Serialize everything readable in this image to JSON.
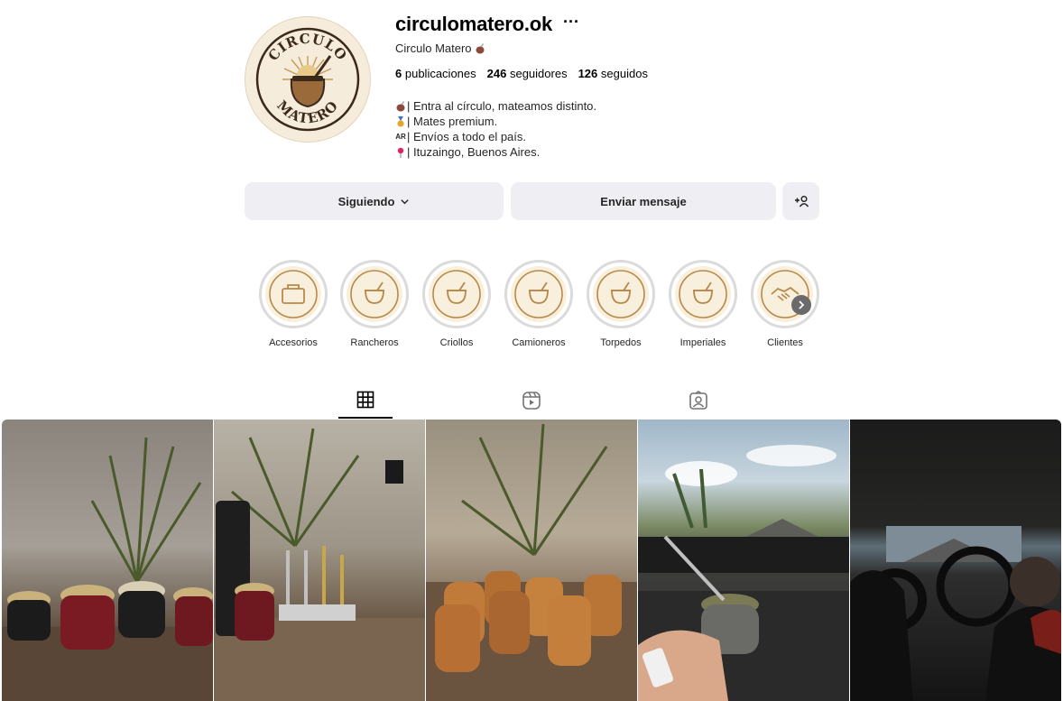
{
  "profile": {
    "username": "circulomatero.ok",
    "more_label": "···",
    "full_name": "Circulo Matero",
    "avatar_text_top": "CIRCULO",
    "avatar_text_bottom": "MATERO",
    "stats": {
      "posts_count": "6",
      "posts_label": "publicaciones",
      "followers_count": "246",
      "followers_label": "seguidores",
      "following_count": "126",
      "following_label": "seguidos"
    },
    "bio": [
      "| Entra al círculo, mateamos distinto.",
      "| Mates premium.",
      "| Envíos a todo el país.",
      "| Ituzaingo, Buenos Aires."
    ],
    "bio_flag": "AR"
  },
  "actions": {
    "following_label": "Siguiendo",
    "message_label": "Enviar mensaje"
  },
  "highlights": [
    {
      "label": "Accesorios"
    },
    {
      "label": "Rancheros"
    },
    {
      "label": "Criollos"
    },
    {
      "label": "Camioneros"
    },
    {
      "label": "Torpedos"
    },
    {
      "label": "Imperiales"
    },
    {
      "label": "Clientes"
    }
  ],
  "tabs": [
    "posts-grid-icon",
    "reels-icon",
    "tagged-icon"
  ],
  "colors": {
    "button_bg": "#efeff3",
    "highlight_bg": "#f8f0dc",
    "brand_brown": "#3b2a1c",
    "brand_gold": "#c79a55"
  }
}
